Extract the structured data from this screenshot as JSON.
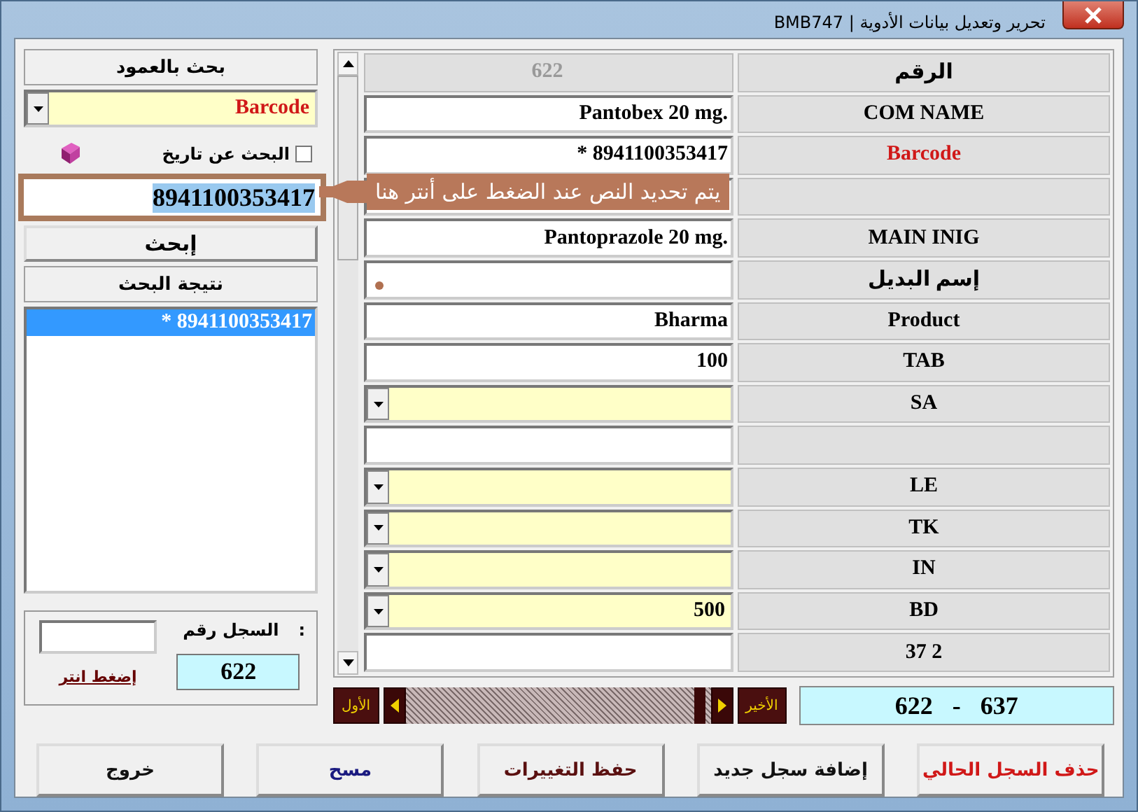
{
  "window": {
    "title": "BMB747 | تحرير وتعديل بيانات الأدوية"
  },
  "search_panel": {
    "header": "بحث بالعمود",
    "column_combo": {
      "value": "Barcode"
    },
    "date_search": {
      "label": "البحث عن تاريخ",
      "checked": false
    },
    "search_field": {
      "value": "8941100353417",
      "text_selected": true
    },
    "search_button": "إبحث",
    "results_header": "نتيجة البحث",
    "results": [
      {
        "text": "* 8941100353417",
        "selected": true
      }
    ]
  },
  "record_box": {
    "label": "السجل رقم",
    "separator": ":",
    "value": "622",
    "link": "إضغط انتر"
  },
  "callout": {
    "text": "يتم تحديد النص عند الضغط على أنتر هنا"
  },
  "fields": [
    {
      "label": "الرقم",
      "kind": "text",
      "value": "622",
      "disabled": true,
      "highlighted": false
    },
    {
      "label": "COM NAME",
      "kind": "text",
      "value": "Pantobex 20 mg.",
      "disabled": false,
      "highlighted": false
    },
    {
      "label": "Barcode",
      "kind": "text",
      "value": "* 8941100353417",
      "disabled": false,
      "highlighted": true
    },
    {
      "kind": "text",
      "disabled": false
    },
    {
      "label": "MAIN INIG",
      "kind": "text",
      "value": "Pantoprazole 20 mg.",
      "disabled": false,
      "highlighted": false
    },
    {
      "label": "إسم البديل",
      "kind": "dot",
      "highlighted": false
    },
    {
      "label": "Product",
      "kind": "text",
      "value": "Bharma",
      "disabled": false,
      "highlighted": false
    },
    {
      "label": "TAB",
      "kind": "text",
      "value": "100",
      "disabled": false,
      "highlighted": false
    },
    {
      "label": "SA",
      "kind": "combo",
      "highlighted": false
    },
    {
      "kind": "text",
      "disabled": false
    },
    {
      "label": "LE",
      "kind": "combo",
      "highlighted": false
    },
    {
      "label": "TK",
      "kind": "combo",
      "highlighted": false
    },
    {
      "label": "IN",
      "kind": "combo",
      "highlighted": false
    },
    {
      "label": "BD",
      "kind": "combo",
      "value": "500",
      "highlighted": false
    },
    {
      "label": "37 2",
      "kind": "text",
      "disabled": false,
      "highlighted": false
    }
  ],
  "navigator": {
    "first": "الأول",
    "last": "الأخير",
    "range_from": "622",
    "separator": "-",
    "range_to": "637"
  },
  "buttons": [
    {
      "label": "حذف السجل الحالي",
      "color": "#d01818"
    },
    {
      "label": "إضافة سجل جديد",
      "color": "#111111"
    },
    {
      "label": "حفظ التغييرات",
      "color": "#5a1010"
    },
    {
      "label": "مسح",
      "color": "#1a1a80"
    },
    {
      "label": "خروج",
      "color": "#111111"
    }
  ]
}
